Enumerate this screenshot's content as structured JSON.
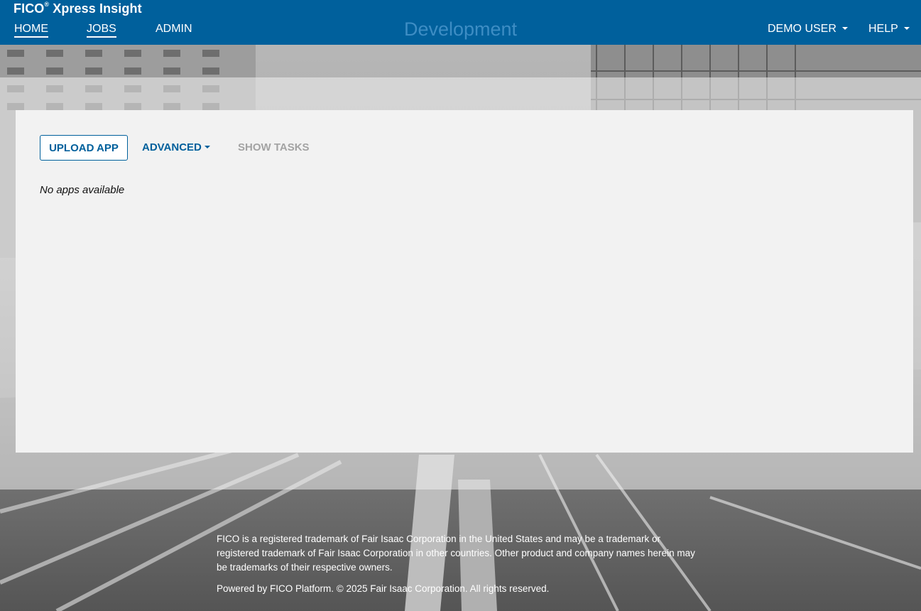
{
  "header": {
    "brand_prefix": "FICO",
    "brand_mark": "®",
    "brand_suffix": "Xpress Insight",
    "nav": [
      {
        "label": "HOME",
        "active": true
      },
      {
        "label": "JOBS",
        "active": true
      },
      {
        "label": "ADMIN",
        "active": false
      }
    ],
    "environment": "Development",
    "user_menu": "DEMO USER",
    "help_menu": "HELP"
  },
  "main": {
    "upload_label": "UPLOAD APP",
    "advanced_label": "ADVANCED",
    "show_tasks_label": "SHOW TASKS",
    "empty_message": "No apps available"
  },
  "footer": {
    "trademark": "FICO is a registered trademark of Fair Isaac Corporation in the United States and may be a trademark or registered trademark of Fair Isaac Corporation in other countries. Other product and company names herein may be trademarks of their respective owners.",
    "powered": "Powered by FICO Platform. © 2025 Fair Isaac Corporation. All rights reserved."
  },
  "colors": {
    "brand_blue": "#00609c",
    "environment_text": "#3d8dc4",
    "disabled_text": "#a3a3a3"
  }
}
